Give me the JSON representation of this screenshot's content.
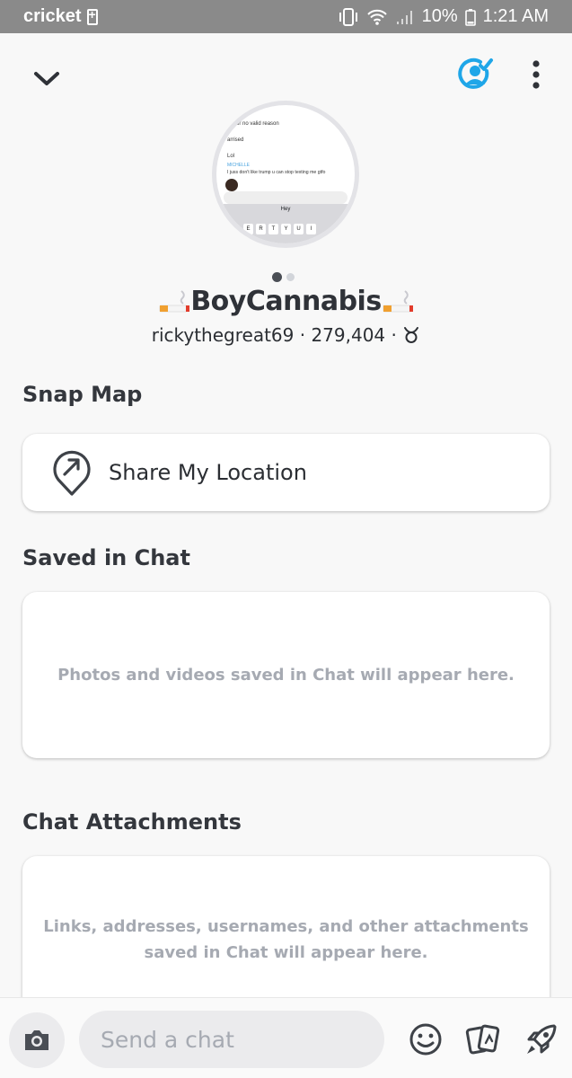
{
  "status_bar": {
    "carrier": "cricket",
    "battery": "10%",
    "time": "1:21 AM"
  },
  "profile": {
    "display_name": "BoyCannabis",
    "username": "rickythegreat69",
    "score": "279,404",
    "separator": "·",
    "bitmoji_preview": {
      "line1": "ng for no valid reason",
      "line2": "arrised",
      "line3": "Lol",
      "tag": "MICHELLE",
      "line4": "I juss don't like trump u can stop texting me gtfo",
      "keyboard_word": "Hey",
      "keys": [
        "E",
        "R",
        "T",
        "Y",
        "U",
        "I"
      ]
    }
  },
  "snap_map": {
    "title": "Snap Map",
    "share_location_label": "Share My Location"
  },
  "saved_in_chat": {
    "title": "Saved in Chat",
    "empty_text": "Photos and videos saved in Chat will appear here."
  },
  "chat_attachments": {
    "title": "Chat Attachments",
    "empty_text_line1": "Links, addresses, usernames, and other attachments",
    "empty_text_line2": "saved in Chat will appear here."
  },
  "chat_bar": {
    "placeholder": "Send a chat"
  },
  "icons": {
    "accent": "#1fa6e8",
    "icon_gray": "#4a4e55"
  }
}
